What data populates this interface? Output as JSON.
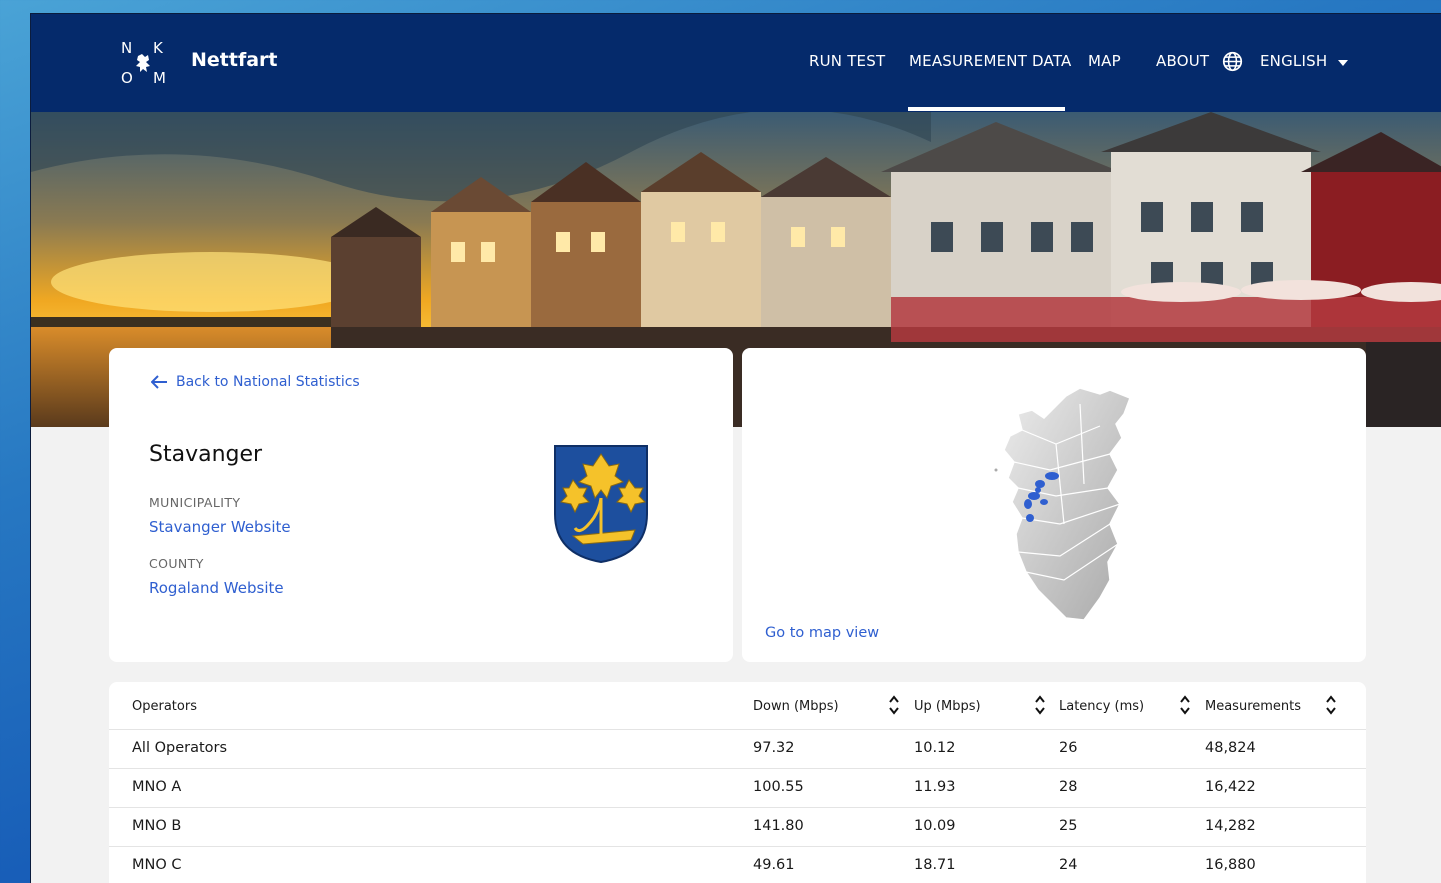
{
  "header": {
    "logo_letters": [
      "N",
      "K",
      "O",
      "M"
    ],
    "brand": "Nettfart",
    "nav": [
      {
        "label": "RUN TEST",
        "active": false
      },
      {
        "label": "MEASUREMENT DATA",
        "active": true
      },
      {
        "label": "MAP",
        "active": false
      },
      {
        "label": "ABOUT",
        "active": false
      }
    ],
    "language": "ENGLISH",
    "language_icon": "globe-icon"
  },
  "info": {
    "back_label": "Back to National Statistics",
    "city": "Stavanger",
    "municipality_label": "MUNICIPALITY",
    "municipality_link": "Stavanger Website",
    "county_label": "COUNTY",
    "county_link": "Rogaland Website"
  },
  "map_card": {
    "link": "Go to map view"
  },
  "table": {
    "columns": [
      "Operators",
      "Down (Mbps)",
      "Up (Mbps)",
      "Latency (ms)",
      "Measurements"
    ],
    "rows": [
      [
        "All Operators",
        "97.32",
        "10.12",
        "26",
        "48,824"
      ],
      [
        "MNO A",
        "100.55",
        "11.93",
        "28",
        "16,422"
      ],
      [
        "MNO B",
        "141.80",
        "10.09",
        "25",
        "14,282"
      ],
      [
        "MNO C",
        "49.61",
        "18.71",
        "24",
        "16,880"
      ]
    ]
  },
  "colors": {
    "header_bg": "#052a6b",
    "link": "#2f5fd0",
    "highlight": "#2f5fd0",
    "crest_blue": "#1d4f9e",
    "crest_gold": "#f5c22a"
  }
}
